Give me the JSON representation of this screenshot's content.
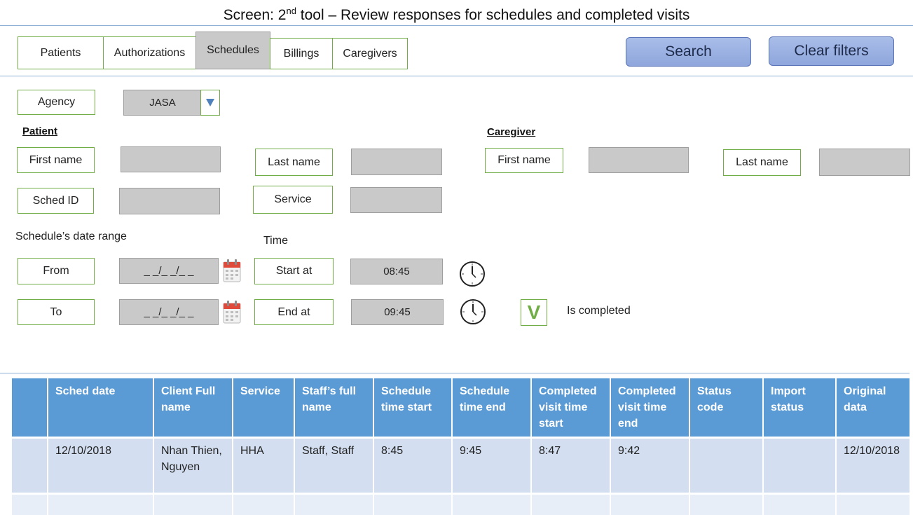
{
  "screen": {
    "title_prefix": "Screen: 2",
    "title_sup": "nd",
    "title_suffix": " tool – Review responses for schedules and completed visits"
  },
  "tabs": [
    {
      "label": "Patients",
      "active": false
    },
    {
      "label": "Authorizations",
      "active": false
    },
    {
      "label": "Schedules",
      "active": true
    },
    {
      "label": "Billings",
      "active": false
    },
    {
      "label": "Caregivers",
      "active": false
    }
  ],
  "actions": {
    "search": "Search",
    "clear": "Clear filters"
  },
  "agency": {
    "label": "Agency",
    "value": "JASA"
  },
  "patient": {
    "heading": "Patient",
    "first_name_label": "First name",
    "first_name_value": "",
    "last_name_label": "Last name",
    "last_name_value": "",
    "sched_id_label": "Sched ID",
    "sched_id_value": "",
    "service_label": "Service",
    "service_value": ""
  },
  "caregiver": {
    "heading": "Caregiver",
    "first_name_label": "First name",
    "first_name_value": "",
    "last_name_label": "Last name",
    "last_name_value": ""
  },
  "date_range": {
    "heading": "Schedule’s date range",
    "from_label": "From",
    "from_value": "_ _/_ _/_ _",
    "to_label": "To",
    "to_value": "_ _/_ _/_ _"
  },
  "time": {
    "heading": "Time",
    "start_label": "Start at",
    "start_value": "08:45",
    "end_label": "End at",
    "end_value": "09:45"
  },
  "completed": {
    "checked": true,
    "mark": "V",
    "label": "Is completed"
  },
  "table": {
    "headers": [
      "",
      "Sched date",
      "Client Full name",
      "Service",
      "Staff’s full name",
      "Schedule time start",
      "Schedule time end",
      "Completed visit time start",
      "Completed visit time end",
      "Status code",
      "Import status",
      "Original data"
    ],
    "rows": [
      [
        "",
        "12/10/2018",
        "Nhan Thien, Nguyen",
        "HHA",
        "Staff, Staff",
        "8:45",
        "9:45",
        "8:47",
        "9:42",
        "",
        "",
        "12/10/2018"
      ],
      [
        "",
        "",
        "",
        "",
        "",
        "",
        "",
        "",
        "",
        "",
        "",
        ""
      ]
    ]
  },
  "icons": {
    "calendar": "calendar-icon",
    "clock": "clock-icon",
    "dropdown": "dropdown-arrow-icon"
  },
  "colors": {
    "label_border": "#70ad47",
    "input_fill": "#c9c9c9",
    "button_fill": "#8ea6dc",
    "table_header": "#5b9bd5",
    "table_row": "#d3dff0"
  }
}
